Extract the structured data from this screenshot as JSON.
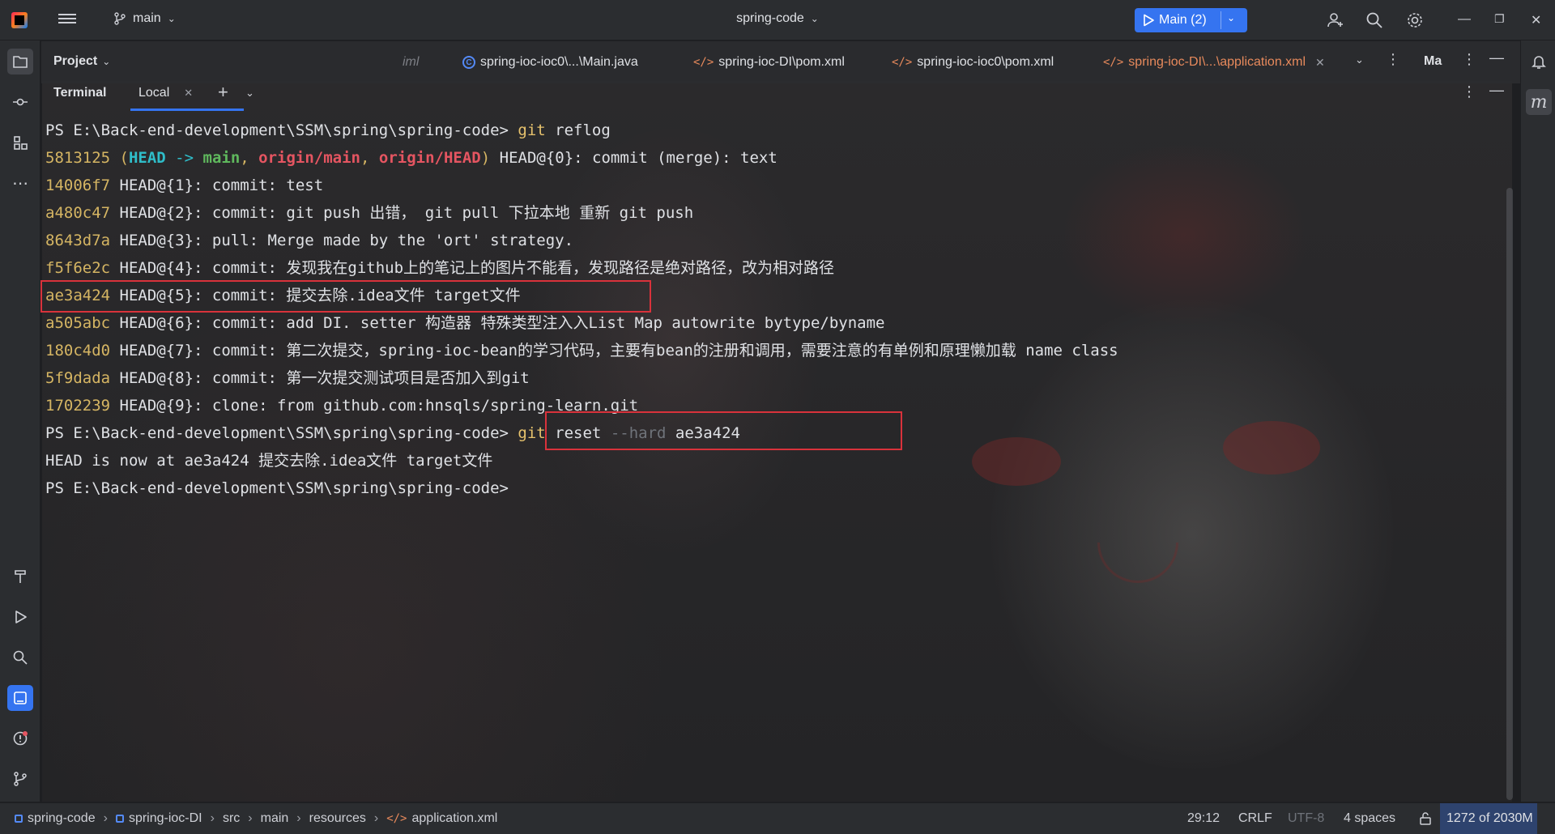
{
  "titlebar": {
    "branch": "main",
    "project": "spring-code",
    "run_config": "Main (2)"
  },
  "header": {
    "project_label": "Project",
    "tabs": [
      {
        "label": "iml",
        "icon": "xml-icon"
      },
      {
        "label": "spring-ioc-ioc0\\...\\Main.java",
        "icon": "class-icon"
      },
      {
        "label": "spring-ioc-DI\\pom.xml",
        "icon": "xml-icon"
      },
      {
        "label": "spring-ioc-ioc0\\pom.xml",
        "icon": "xml-icon"
      },
      {
        "label": "spring-ioc-DI\\...\\application.xml",
        "icon": "xml-icon",
        "active": true
      }
    ],
    "overflow_label": "Ma"
  },
  "terminal": {
    "title": "Terminal",
    "tab_label": "Local",
    "lines": [
      {
        "prompt": "PS E:\\Back-end-development\\SSM\\spring\\spring-code>",
        "cmd": "git",
        "rest": " reflog"
      },
      {
        "hash": "5813125",
        "ref_open": " (",
        "head": "HEAD",
        "arrow": " -> ",
        "main": "main",
        "c1": ", ",
        "om": "origin/main",
        "c2": ", ",
        "oh": "origin/HEAD",
        "ref_close": ")",
        "text": " HEAD@{0}: commit (merge): text"
      },
      {
        "hash": "14006f7",
        "text": " HEAD@{1}: commit: test"
      },
      {
        "hash": "a480c47",
        "text": " HEAD@{2}: commit: git push 出错， git pull 下拉本地 重新 git push"
      },
      {
        "hash": "8643d7a",
        "text": " HEAD@{3}: pull: Merge made by the 'ort' strategy."
      },
      {
        "hash": "f5f6e2c",
        "text": " HEAD@{4}: commit: 发现我在github上的笔记上的图片不能看，发现路径是绝对路径，改为相对路径"
      },
      {
        "hash": "ae3a424",
        "text": " HEAD@{5}: commit: 提交去除.idea文件 target文件"
      },
      {
        "hash": "a505abc",
        "text": " HEAD@{6}: commit: add DI. setter 构造器 特殊类型注入入List Map autowrite bytype/byname"
      },
      {
        "hash": "180c4d0",
        "text": " HEAD@{7}: commit: 第二次提交，spring-ioc-bean的学习代码，主要有bean的注册和调用，需要注意的有单例和原理懒加载 name class"
      },
      {
        "hash": "5f9dada",
        "text": " HEAD@{8}: commit: 第一次提交测试项目是否加入到git"
      },
      {
        "hash": "1702239",
        "text": " HEAD@{9}: clone: from github.com:hnsqls/spring-learn.git"
      },
      {
        "prompt": "PS E:\\Back-end-development\\SSM\\spring\\spring-code>",
        "cmd": "git",
        "rest": " reset",
        "flag": " --hard",
        "arg": " ae3a424"
      },
      {
        "plain": "HEAD is now at ae3a424 提交去除.idea文件 target文件"
      },
      {
        "prompt": "PS E:\\Back-end-development\\SSM\\spring\\spring-code>"
      }
    ]
  },
  "statusbar": {
    "breadcrumbs": [
      "spring-code",
      "spring-ioc-DI",
      "src",
      "main",
      "resources",
      "application.xml"
    ],
    "position": "29:12",
    "line_sep": "CRLF",
    "encoding": "UTF-8",
    "indent": "4 spaces",
    "memory": "1272 of 2030M"
  },
  "colors": {
    "accent": "#3574f0",
    "hash": "#d5b563",
    "highlight_box": "#d9323b"
  }
}
